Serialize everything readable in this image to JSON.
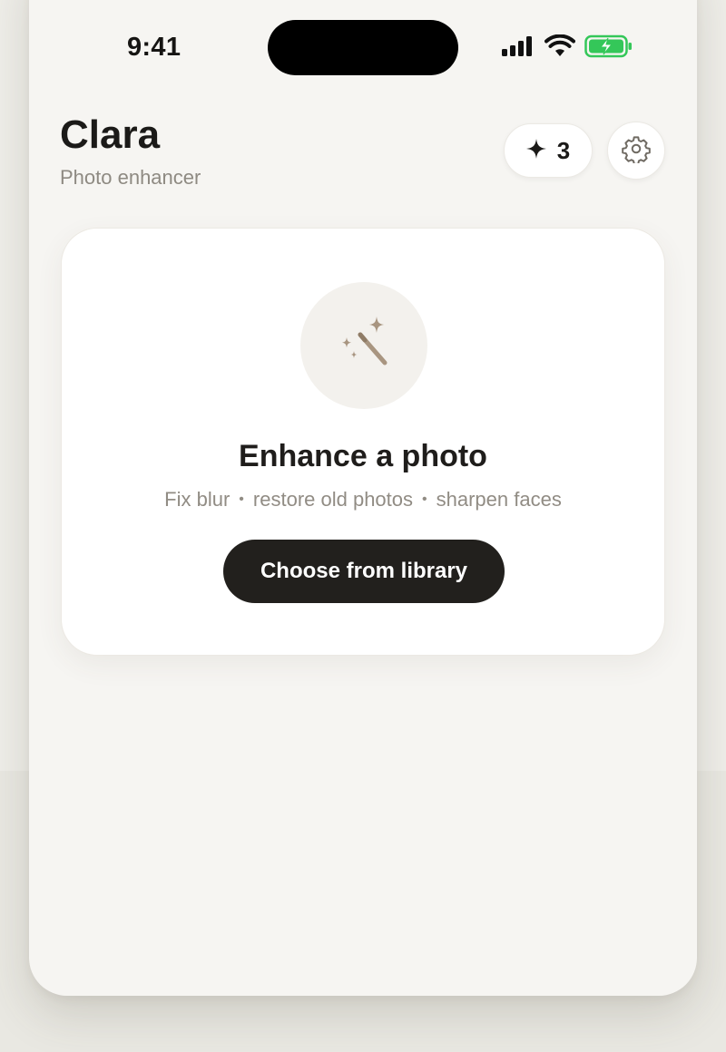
{
  "status_bar": {
    "time": "9:41",
    "icons": [
      "cellular-signal-icon",
      "wifi-icon",
      "battery-charging-icon"
    ],
    "battery_color": "#34c759"
  },
  "header": {
    "title": "Clara",
    "subtitle": "Photo enhancer",
    "credits": {
      "icon": "sparkle-icon",
      "count": "3"
    },
    "settings_icon": "gear-icon"
  },
  "upload_card": {
    "icon": "magic-wand-icon",
    "title": "Enhance a photo",
    "features": [
      "Fix blur",
      "restore old photos",
      "sharpen faces"
    ],
    "separator": "•",
    "button_label": "Choose from library"
  },
  "colors": {
    "accent_icon": "#a89580",
    "button_bg": "#22201d",
    "background": "#f6f5f2"
  }
}
